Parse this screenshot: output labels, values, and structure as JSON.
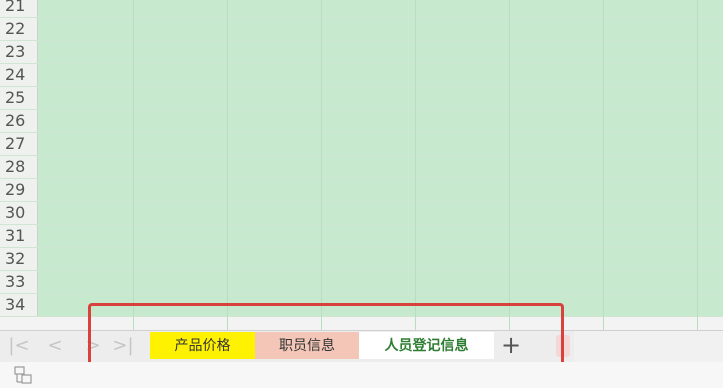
{
  "grid": {
    "row_numbers": [
      "21",
      "22",
      "23",
      "24",
      "25",
      "26",
      "27",
      "28",
      "29",
      "30",
      "31",
      "32",
      "33",
      "34"
    ]
  },
  "sheet_tabs": [
    {
      "label": "产品价格",
      "color": "#fff200",
      "active": false
    },
    {
      "label": "职员信息",
      "color": "#f3c6b8",
      "active": false
    },
    {
      "label": "人员登记信息",
      "color": "#ffffff",
      "active": true
    }
  ],
  "nav_buttons": {
    "first": "|<",
    "prev": "<",
    "next": ">",
    "last": ">|"
  },
  "add_sheet_label": "+",
  "colors": {
    "grid_fill": "#c7eacf",
    "highlight": "#d9423c",
    "active_tab_text": "#2e7d32"
  },
  "icons": {
    "status": "sheet-layout-icon",
    "add": "plus-icon"
  }
}
